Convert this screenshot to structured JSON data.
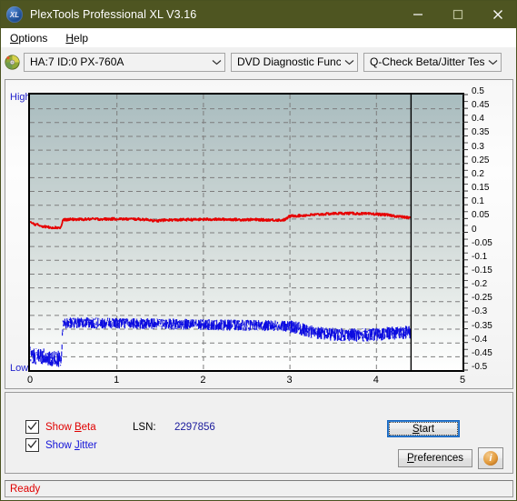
{
  "window": {
    "title": "PlexTools Professional XL V3.16",
    "icon": "xl-logo-icon",
    "minimize_label": "—",
    "maximize_label": "□",
    "close_label": "✕",
    "titlebar_color": "#4e5521"
  },
  "menu": {
    "items": [
      {
        "label": "Options",
        "accel": "O"
      },
      {
        "label": "Help",
        "accel": "H"
      }
    ]
  },
  "toolbar": {
    "drive_icon": "disc-icon",
    "drive_select": {
      "value": "HA:7 ID:0  PX-760A",
      "chevron": "chevron-down-icon"
    },
    "function_select": {
      "value": "DVD Diagnostic Functions",
      "chevron": "chevron-down-icon"
    },
    "test_select": {
      "value": "Q-Check Beta/Jitter Test",
      "chevron": "chevron-down-icon"
    }
  },
  "chart_axis": {
    "high_label": "High",
    "low_label": "Low",
    "y_ticks": [
      "0.5",
      "0.45",
      "0.4",
      "0.35",
      "0.3",
      "0.25",
      "0.2",
      "0.15",
      "0.1",
      "0.05",
      "0",
      "-0.05",
      "-0.1",
      "-0.15",
      "-0.2",
      "-0.25",
      "-0.3",
      "-0.35",
      "-0.4",
      "-0.45",
      "-0.5"
    ],
    "x_ticks": [
      "0",
      "1",
      "2",
      "3",
      "4",
      "5"
    ]
  },
  "controls": {
    "show_beta": {
      "label": "Show Beta",
      "accel": "B",
      "checked": true,
      "color": "#e00000"
    },
    "show_jitter": {
      "label": "Show Jitter",
      "accel": "J",
      "checked": true,
      "color": "#1414d8"
    },
    "lsn_label": "LSN:",
    "lsn_value": "2297856",
    "start_button": {
      "label": "Start",
      "accel": "S",
      "focused": true
    },
    "preferences_button": {
      "label": "Preferences",
      "accel": "P"
    },
    "info_button": {
      "label": "i",
      "icon": "info-icon"
    }
  },
  "status": {
    "text": "Ready",
    "color": "#e00000"
  },
  "chart_data": {
    "type": "line",
    "title": "Q-Check Beta/Jitter Test",
    "xlabel": "",
    "ylabel": "",
    "xlim": [
      0,
      5
    ],
    "ylim": [
      -0.5,
      0.5
    ],
    "grid": true,
    "legend": "none",
    "data_end_marker_x": 4.4,
    "series": [
      {
        "name": "Beta",
        "color": "#e60000",
        "x": [
          0.0,
          0.05,
          0.1,
          0.15,
          0.2,
          0.25,
          0.3,
          0.34,
          0.36,
          0.38,
          0.42,
          0.5,
          0.6,
          0.7,
          0.8,
          0.9,
          1.0,
          1.1,
          1.2,
          1.3,
          1.4,
          1.45,
          1.5,
          1.6,
          1.7,
          1.8,
          1.9,
          2.0,
          2.1,
          2.2,
          2.3,
          2.4,
          2.5,
          2.6,
          2.7,
          2.8,
          2.9,
          2.95,
          3.0,
          3.05,
          3.1,
          3.2,
          3.3,
          3.4,
          3.5,
          3.6,
          3.7,
          3.8,
          3.9,
          4.0,
          4.1,
          4.2,
          4.3,
          4.4
        ],
        "y": [
          0.036,
          0.03,
          0.026,
          0.022,
          0.019,
          0.018,
          0.017,
          0.017,
          0.018,
          0.045,
          0.046,
          0.047,
          0.047,
          0.048,
          0.048,
          0.048,
          0.049,
          0.048,
          0.048,
          0.047,
          0.045,
          0.04,
          0.043,
          0.045,
          0.045,
          0.046,
          0.046,
          0.047,
          0.047,
          0.047,
          0.047,
          0.046,
          0.046,
          0.046,
          0.045,
          0.045,
          0.044,
          0.046,
          0.058,
          0.06,
          0.06,
          0.062,
          0.064,
          0.066,
          0.068,
          0.069,
          0.069,
          0.068,
          0.067,
          0.066,
          0.064,
          0.06,
          0.056,
          0.052
        ]
      },
      {
        "name": "Jitter",
        "color": "#0c0ce0",
        "noise_band": 0.022,
        "x": [
          0.0,
          0.05,
          0.1,
          0.15,
          0.2,
          0.25,
          0.3,
          0.34,
          0.36,
          0.38,
          0.45,
          0.55,
          0.7,
          0.85,
          1.0,
          1.2,
          1.4,
          1.6,
          1.8,
          2.0,
          2.2,
          2.4,
          2.6,
          2.8,
          3.0,
          3.1,
          3.2,
          3.3,
          3.4,
          3.5,
          3.6,
          3.7,
          3.8,
          3.9,
          4.0,
          4.1,
          4.2,
          4.3,
          4.4
        ],
        "y": [
          -0.44,
          -0.45,
          -0.452,
          -0.45,
          -0.455,
          -0.458,
          -0.458,
          -0.46,
          -0.458,
          -0.33,
          -0.328,
          -0.328,
          -0.329,
          -0.33,
          -0.33,
          -0.331,
          -0.332,
          -0.333,
          -0.334,
          -0.335,
          -0.336,
          -0.337,
          -0.338,
          -0.339,
          -0.342,
          -0.348,
          -0.356,
          -0.363,
          -0.368,
          -0.37,
          -0.371,
          -0.372,
          -0.373,
          -0.372,
          -0.371,
          -0.368,
          -0.366,
          -0.364,
          -0.362
        ]
      }
    ]
  }
}
